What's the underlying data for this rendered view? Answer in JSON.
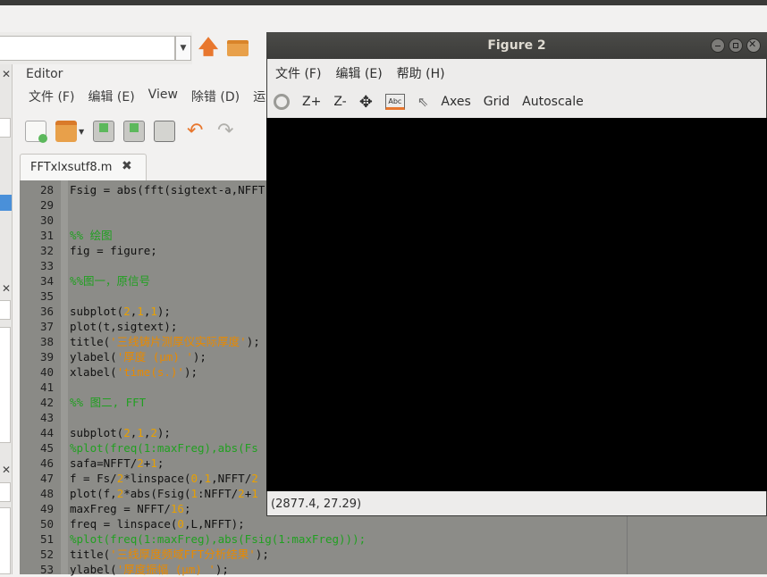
{
  "editor": {
    "title": "Editor",
    "menu": [
      "文件 (F)",
      "编辑 (E)",
      "View",
      "除错 (D)",
      "运"
    ],
    "tab_label": "FFTxlxsutf8.m",
    "lines": [
      {
        "n": "28",
        "segs": [
          [
            "Fsig = abs(fft(sigtext-a,NFFT",
            ""
          ]
        ]
      },
      {
        "n": "29",
        "segs": []
      },
      {
        "n": "30",
        "segs": []
      },
      {
        "n": "31",
        "segs": [
          [
            "%% 绘图",
            "c-green"
          ]
        ]
      },
      {
        "n": "32",
        "segs": [
          [
            "fig = figure;",
            ""
          ]
        ]
      },
      {
        "n": "33",
        "segs": []
      },
      {
        "n": "34",
        "segs": [
          [
            "%%图一，原信号",
            "c-green"
          ]
        ]
      },
      {
        "n": "35",
        "segs": []
      },
      {
        "n": "36",
        "segs": [
          [
            "subplot(",
            ""
          ],
          [
            "2",
            "c-num"
          ],
          [
            ",",
            ""
          ],
          [
            "1",
            "c-num"
          ],
          [
            ",",
            ""
          ],
          [
            "1",
            "c-num"
          ],
          [
            ");",
            ""
          ]
        ]
      },
      {
        "n": "37",
        "segs": [
          [
            "plot(t,sigtext);",
            ""
          ]
        ]
      },
      {
        "n": "38",
        "segs": [
          [
            "title(",
            ""
          ],
          [
            "'三线铸片测厚仪实际厚度'",
            "c-orange"
          ],
          [
            ");",
            ""
          ]
        ]
      },
      {
        "n": "39",
        "segs": [
          [
            "ylabel(",
            ""
          ],
          [
            "'厚度 (μm) '",
            "c-orange"
          ],
          [
            ");",
            ""
          ]
        ]
      },
      {
        "n": "40",
        "segs": [
          [
            "xlabel(",
            ""
          ],
          [
            "'time(s.)'",
            "c-orange"
          ],
          [
            ");",
            ""
          ]
        ]
      },
      {
        "n": "41",
        "segs": []
      },
      {
        "n": "42",
        "segs": [
          [
            "%% 图二, FFT",
            "c-green"
          ]
        ]
      },
      {
        "n": "43",
        "segs": []
      },
      {
        "n": "44",
        "segs": [
          [
            "subplot(",
            ""
          ],
          [
            "2",
            "c-num"
          ],
          [
            ",",
            ""
          ],
          [
            "1",
            "c-num"
          ],
          [
            ",",
            ""
          ],
          [
            "2",
            "c-num"
          ],
          [
            ");",
            ""
          ]
        ]
      },
      {
        "n": "45",
        "segs": [
          [
            "%plot(freq(1:maxFreg),abs(Fs",
            "c-green"
          ]
        ]
      },
      {
        "n": "46",
        "segs": [
          [
            "safa=NFFT/",
            ""
          ],
          [
            "2",
            "c-num"
          ],
          [
            "+",
            ""
          ],
          [
            "1",
            "c-num"
          ],
          [
            ";",
            ""
          ]
        ]
      },
      {
        "n": "47",
        "segs": [
          [
            "f = Fs/",
            ""
          ],
          [
            "2",
            "c-num"
          ],
          [
            "*linspace(",
            ""
          ],
          [
            "0",
            "c-num"
          ],
          [
            ",",
            ""
          ],
          [
            "1",
            "c-num"
          ],
          [
            ",NFFT/",
            ""
          ],
          [
            "2",
            "c-num"
          ]
        ]
      },
      {
        "n": "48",
        "segs": [
          [
            "plot(f,",
            ""
          ],
          [
            "2",
            "c-num"
          ],
          [
            "*abs(Fsig(",
            ""
          ],
          [
            "1",
            "c-num"
          ],
          [
            ":NFFT/",
            ""
          ],
          [
            "2",
            "c-num"
          ],
          [
            "+",
            ""
          ],
          [
            "1",
            "c-num"
          ]
        ]
      },
      {
        "n": "49",
        "segs": [
          [
            "maxFreg = NFFT/",
            ""
          ],
          [
            "16",
            "c-num"
          ],
          [
            ";",
            ""
          ]
        ]
      },
      {
        "n": "50",
        "segs": [
          [
            "freq = linspace(",
            ""
          ],
          [
            "0",
            "c-num"
          ],
          [
            ",L,NFFT);",
            ""
          ]
        ]
      },
      {
        "n": "51",
        "segs": [
          [
            "%plot(freq(1:maxFreg),abs(Fsig(1:maxFreg)));",
            "c-green"
          ]
        ]
      },
      {
        "n": "52",
        "segs": [
          [
            "title(",
            ""
          ],
          [
            "'三线厚度频域FFT分析结果'",
            "c-orange"
          ],
          [
            ");",
            ""
          ]
        ]
      },
      {
        "n": "53",
        "segs": [
          [
            "ylabel(",
            ""
          ],
          [
            "'厚度振幅 (μm) '",
            "c-orange"
          ],
          [
            ");",
            ""
          ]
        ]
      }
    ]
  },
  "figure": {
    "title": "Figure 2",
    "menu": [
      "文件 (F)",
      "编辑 (E)",
      "帮助 (H)"
    ],
    "tools": [
      "Z+",
      "Z-",
      "Axes",
      "Grid",
      "Autoscale"
    ],
    "coordinates": "(2877.4, 27.29)"
  },
  "colors": {
    "plot_bg": "#000000",
    "code_bg": "#8c8c88",
    "comment": "#21a021",
    "string": "#e88a00"
  }
}
